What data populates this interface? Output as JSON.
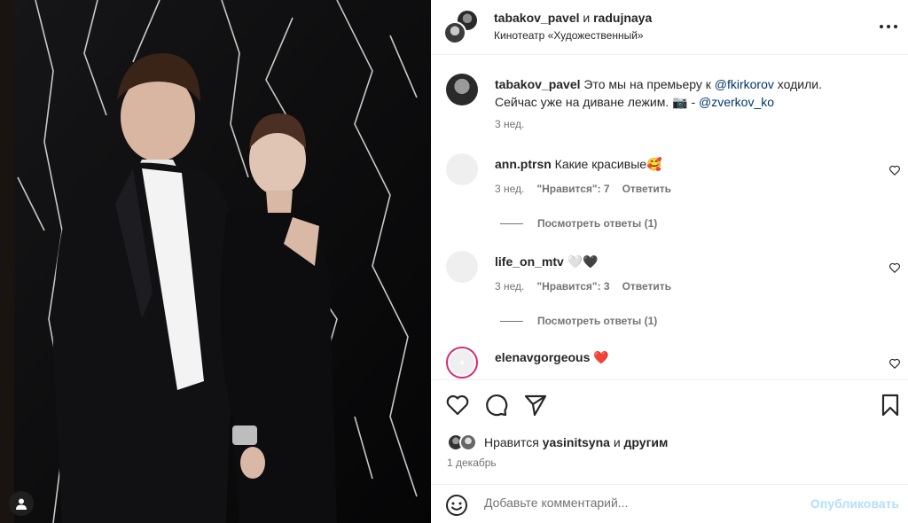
{
  "header": {
    "user1": "tabakov_pavel",
    "and": " и ",
    "user2": "radujnaya",
    "location": "Кинотеатр «Художественный»",
    "more_icon": "more-horizontal-icon"
  },
  "caption": {
    "username": "tabakov_pavel",
    "text1": " Это мы на премьеру к ",
    "mention1": "@fkirkorov",
    "text2": " ходили. Сейчас уже на диване лежим. 📷 - ",
    "mention2": "@zverkov_ko",
    "time": "3 нед."
  },
  "comments": [
    {
      "username": "ann.ptrsn",
      "text": " Какие красивые🥰",
      "time": "3 нед.",
      "likes": "\"Нравится\": 7",
      "reply": "Ответить",
      "view_replies": "Посмотреть ответы (1)"
    },
    {
      "username": "life_on_mtv",
      "text": " 🤍🖤",
      "time": "3 нед.",
      "likes": "\"Нравится\": 3",
      "reply": "Ответить",
      "view_replies": "Посмотреть ответы (1)"
    },
    {
      "username": "elenavgorgeous",
      "text": " ❤️"
    }
  ],
  "likes_line": {
    "prefix": "Нравится ",
    "user": "yasinitsyna",
    "mid": " и ",
    "others": "другим"
  },
  "date": "1 декабрь",
  "add_comment": {
    "placeholder": "Добавьте комментарий...",
    "post_label": "Опубликовать"
  },
  "colors": {
    "link": "#00376b",
    "post_disabled": "#b2dffc",
    "muted": "#737373"
  }
}
